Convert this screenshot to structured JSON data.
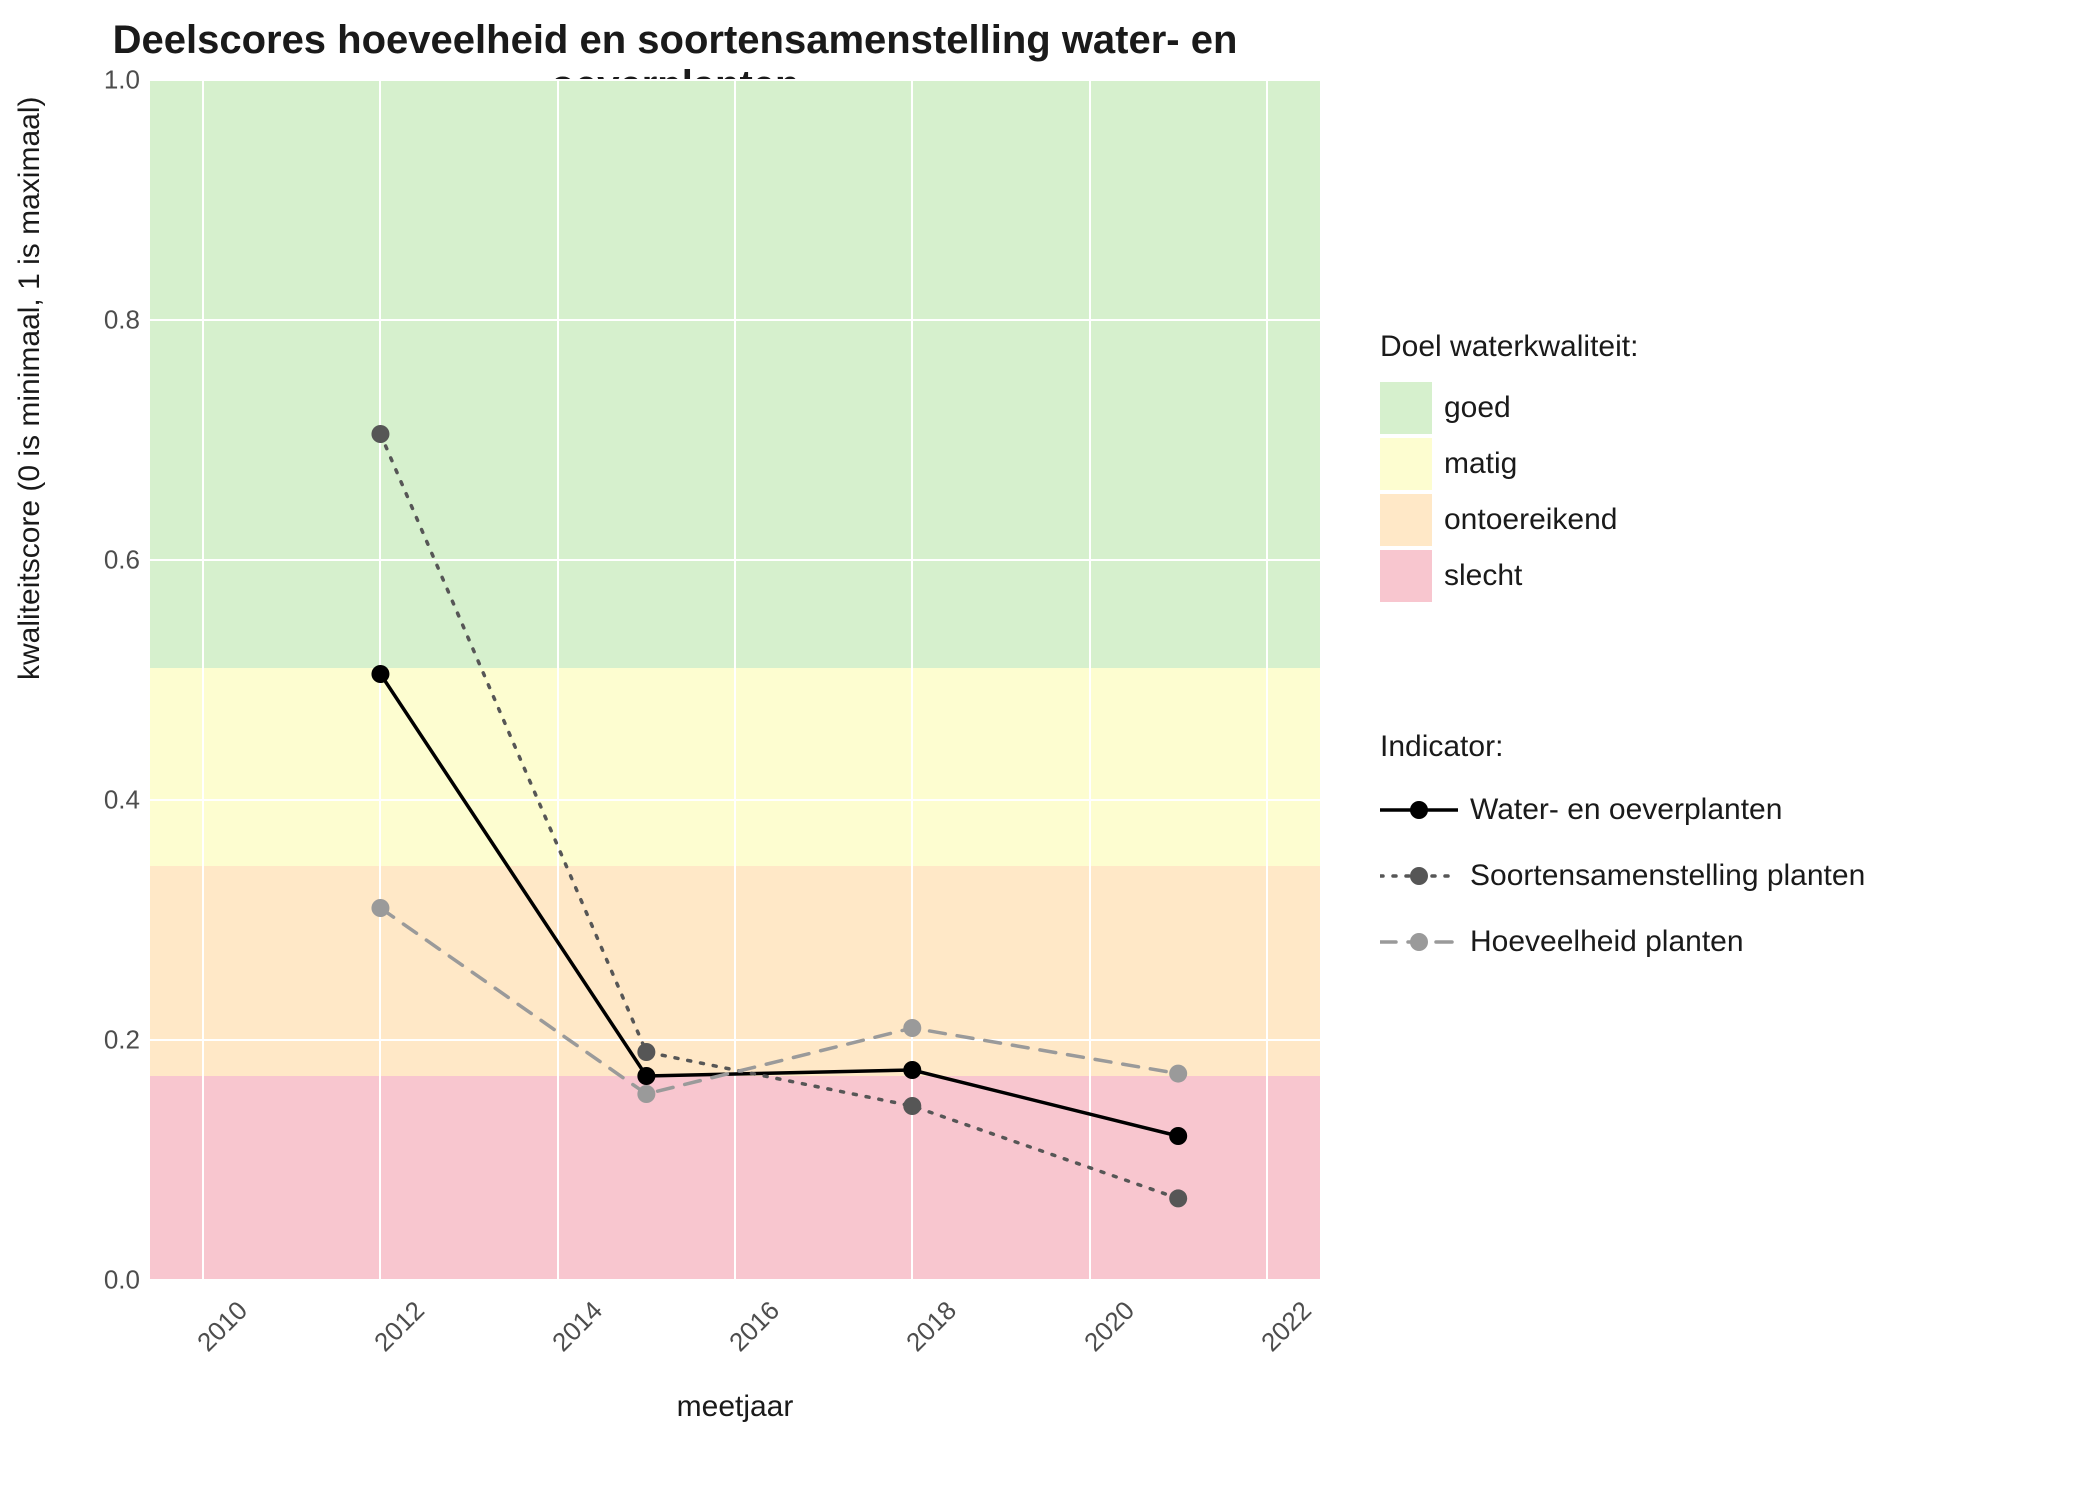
{
  "title": "Deelscores hoeveelheid en soortensamenstelling water- en oeverplanten",
  "xlabel": "meetjaar",
  "ylabel": "kwaliteitscore (0 is minimaal, 1 is maximaal)",
  "legend_bands_title": "Doel waterkwaliteit:",
  "legend_series_title": "Indicator:",
  "bands": {
    "goed": {
      "label": "goed",
      "color": "#d6f0cd",
      "from": 0.51,
      "to": 1.0
    },
    "matig": {
      "label": "matig",
      "color": "#fdfdd0",
      "from": 0.345,
      "to": 0.51
    },
    "ontoer": {
      "label": "ontoereikend",
      "color": "#ffe8c7",
      "from": 0.17,
      "to": 0.345
    },
    "slecht": {
      "label": "slecht",
      "color": "#f8c6cf",
      "from": 0.0,
      "to": 0.17
    }
  },
  "yticks": [
    "0.0",
    "0.2",
    "0.4",
    "0.6",
    "0.8",
    "1.0"
  ],
  "xticks": [
    "2010",
    "2012",
    "2014",
    "2016",
    "2018",
    "2020",
    "2022"
  ],
  "chart_data": {
    "type": "line",
    "xlim": [
      2009.4,
      2022.6
    ],
    "ylim": [
      0.0,
      1.0
    ],
    "x": [
      2012,
      2015,
      2018,
      2021
    ],
    "series": [
      {
        "name": "Water- en oeverplanten",
        "style": "solid",
        "color": "#000000",
        "values": [
          0.505,
          0.17,
          0.175,
          0.12
        ]
      },
      {
        "name": "Soortensamenstelling planten",
        "style": "dotted",
        "color": "#565656",
        "values": [
          0.705,
          0.19,
          0.145,
          0.068
        ]
      },
      {
        "name": "Hoeveelheid planten",
        "style": "dashed",
        "color": "#9a9a9a",
        "values": [
          0.31,
          0.155,
          0.21,
          0.172
        ]
      }
    ],
    "bands": [
      {
        "name": "goed",
        "from": 0.51,
        "to": 1.0,
        "color": "#d6f0cd"
      },
      {
        "name": "matig",
        "from": 0.345,
        "to": 0.51,
        "color": "#fdfdd0"
      },
      {
        "name": "ontoereikend",
        "from": 0.17,
        "to": 0.345,
        "color": "#ffe8c7"
      },
      {
        "name": "slecht",
        "from": 0.0,
        "to": 0.17,
        "color": "#f8c6cf"
      }
    ],
    "title": "Deelscores hoeveelheid en soortensamenstelling water- en oeverplanten",
    "xlabel": "meetjaar",
    "ylabel": "kwaliteitscore (0 is minimaal, 1 is maximaal)"
  }
}
